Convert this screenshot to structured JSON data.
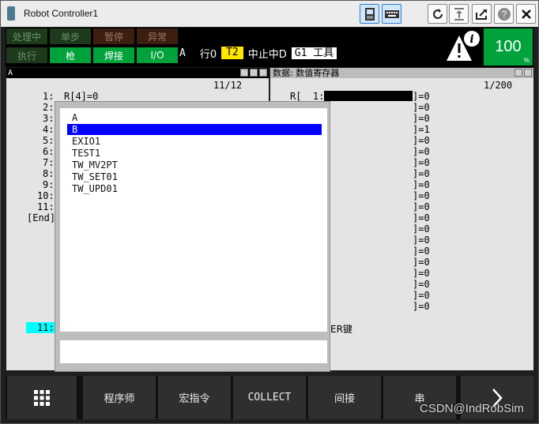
{
  "window": {
    "title": "Robot Controller1",
    "buttons": [
      "teach-pendant-icon",
      "keyboard-icon",
      "refresh-icon",
      "jog-icon",
      "export-icon",
      "help-icon",
      "close-icon"
    ]
  },
  "status": {
    "indicators_top": [
      "处理中",
      "单步",
      "暂停",
      "异常"
    ],
    "indicators_bottom": [
      "执行",
      "枪",
      "焊接",
      "I/O"
    ],
    "program": "A",
    "line_label": "行0",
    "mode": "T2",
    "state": "中止中D",
    "group_tool": "G1 工具",
    "override": "100",
    "override_unit": "%"
  },
  "left_panel": {
    "header": "A",
    "position": "11/12",
    "lines": [
      {
        "num": "1:",
        "text": "R[4]=0"
      },
      {
        "num": "2:",
        "text": ""
      },
      {
        "num": "3:",
        "text": ""
      },
      {
        "num": "4:",
        "text": ""
      },
      {
        "num": "5:",
        "text": ""
      },
      {
        "num": "6:",
        "text": ""
      },
      {
        "num": "7:",
        "text": ""
      },
      {
        "num": "8:",
        "text": ""
      },
      {
        "num": "9:",
        "text": ""
      },
      {
        "num": "10:",
        "text": ""
      },
      {
        "num": "11:",
        "text": ""
      },
      {
        "num": "[End]",
        "text": ""
      }
    ],
    "cursor_line": "11:"
  },
  "right_panel": {
    "header": "数据: 数值寄存器",
    "position": "1/200",
    "first_row": "R[  1:",
    "values": [
      "]=0",
      "]=0",
      "]=0",
      "]=1",
      "]=0",
      "]=0",
      "]=0",
      "]=0",
      "]=0",
      "]=0",
      "]=0",
      "]=0",
      "]=0",
      "]=0",
      "]=0",
      "]=0",
      "]=0",
      "]=0",
      "]=0",
      "]=0"
    ],
    "hint_fragment": "ER键"
  },
  "dialog": {
    "items": [
      "A",
      "B",
      "EXIO1",
      "TEST1",
      "TW_MV2PT",
      "TW_SET01",
      "TW_UPD01"
    ],
    "selected": "B"
  },
  "function_keys": [
    "menu-grid-icon",
    "程序师",
    "宏指令",
    "COLLECT",
    "间接",
    "串",
    "next-icon"
  ],
  "watermark": "CSDN@IndRobSim"
}
